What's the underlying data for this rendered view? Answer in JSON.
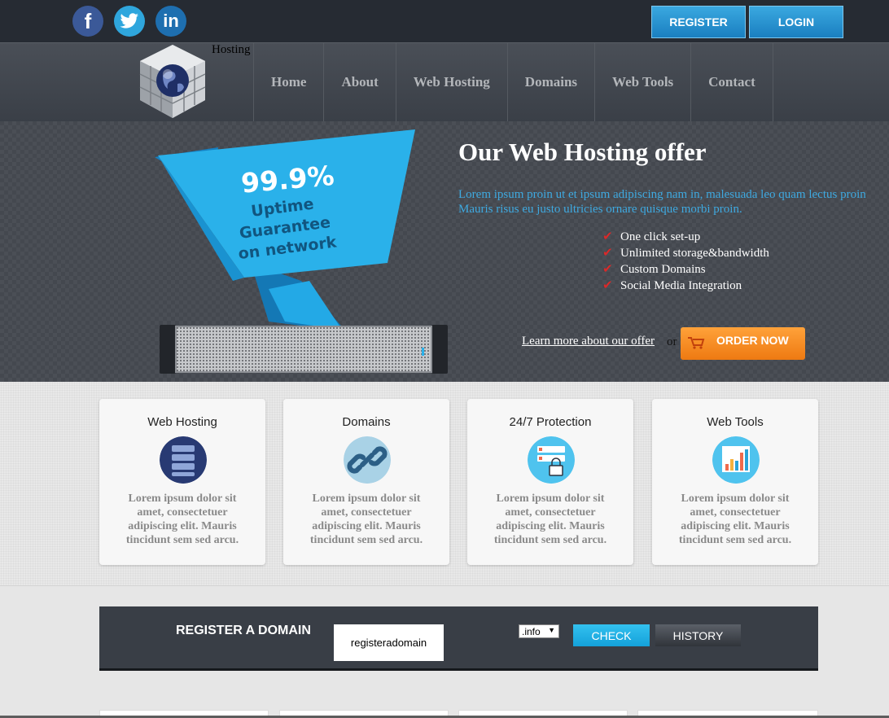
{
  "header": {
    "social": [
      {
        "name": "facebook",
        "glyph": "f"
      },
      {
        "name": "twitter",
        "glyph": "t"
      },
      {
        "name": "linkedin",
        "glyph": "in"
      }
    ],
    "register_label": "REGISTER",
    "login_label": "LOGIN"
  },
  "nav": {
    "logo_text": "Hosting",
    "items": [
      "Home",
      "About",
      "Web Hosting",
      "Domains",
      "Web Tools",
      "Contact"
    ]
  },
  "hero": {
    "banner_percent": "99.9%",
    "banner_line1": "Uptime Guarantee",
    "banner_line2": "on network",
    "title": "Our Web Hosting offer",
    "desc_line1": "Lorem ipsum proin ut et ipsum adipiscing nam in, malesuada leo quam lectus proin",
    "desc_line2": "Mauris risus eu justo ultricies ornare quisque morbi proin.",
    "features": [
      "One click set-up",
      "Unlimited storage&bandwidth",
      "Custom Domains",
      "Social Media Integration"
    ],
    "learn_more": "Learn more about our offer",
    "or_text": "or",
    "order_now": "ORDER NOW"
  },
  "cards": [
    {
      "title": "Web Hosting",
      "icon": "server-icon",
      "text": "Lorem ipsum dolor sit amet, consectetuer adipiscing elit. Mauris tincidunt sem sed arcu."
    },
    {
      "title": "Domains",
      "icon": "chain-link-icon",
      "text": "Lorem ipsum dolor sit amet, consectetuer adipiscing elit. Mauris tincidunt sem sed arcu."
    },
    {
      "title": "24/7 Protection",
      "icon": "lock-server-icon",
      "text": "Lorem ipsum dolor sit amet, consectetuer adipiscing elit. Mauris tincidunt sem sed arcu."
    },
    {
      "title": "Web Tools",
      "icon": "bar-chart-icon",
      "text": "Lorem ipsum dolor sit amet, consectetuer adipiscing elit. Mauris tincidunt sem sed arcu."
    }
  ],
  "domain": {
    "label": "REGISTER A DOMAIN",
    "input_value": "registeradomain",
    "tld_selected": ".info",
    "check_label": "CHECK",
    "history_label": "HISTORY"
  },
  "colors": {
    "topbar": "#262b33",
    "accent_blue": "#1a9be0",
    "order_orange": "#f08a1e",
    "check_red": "#d92a2a"
  }
}
